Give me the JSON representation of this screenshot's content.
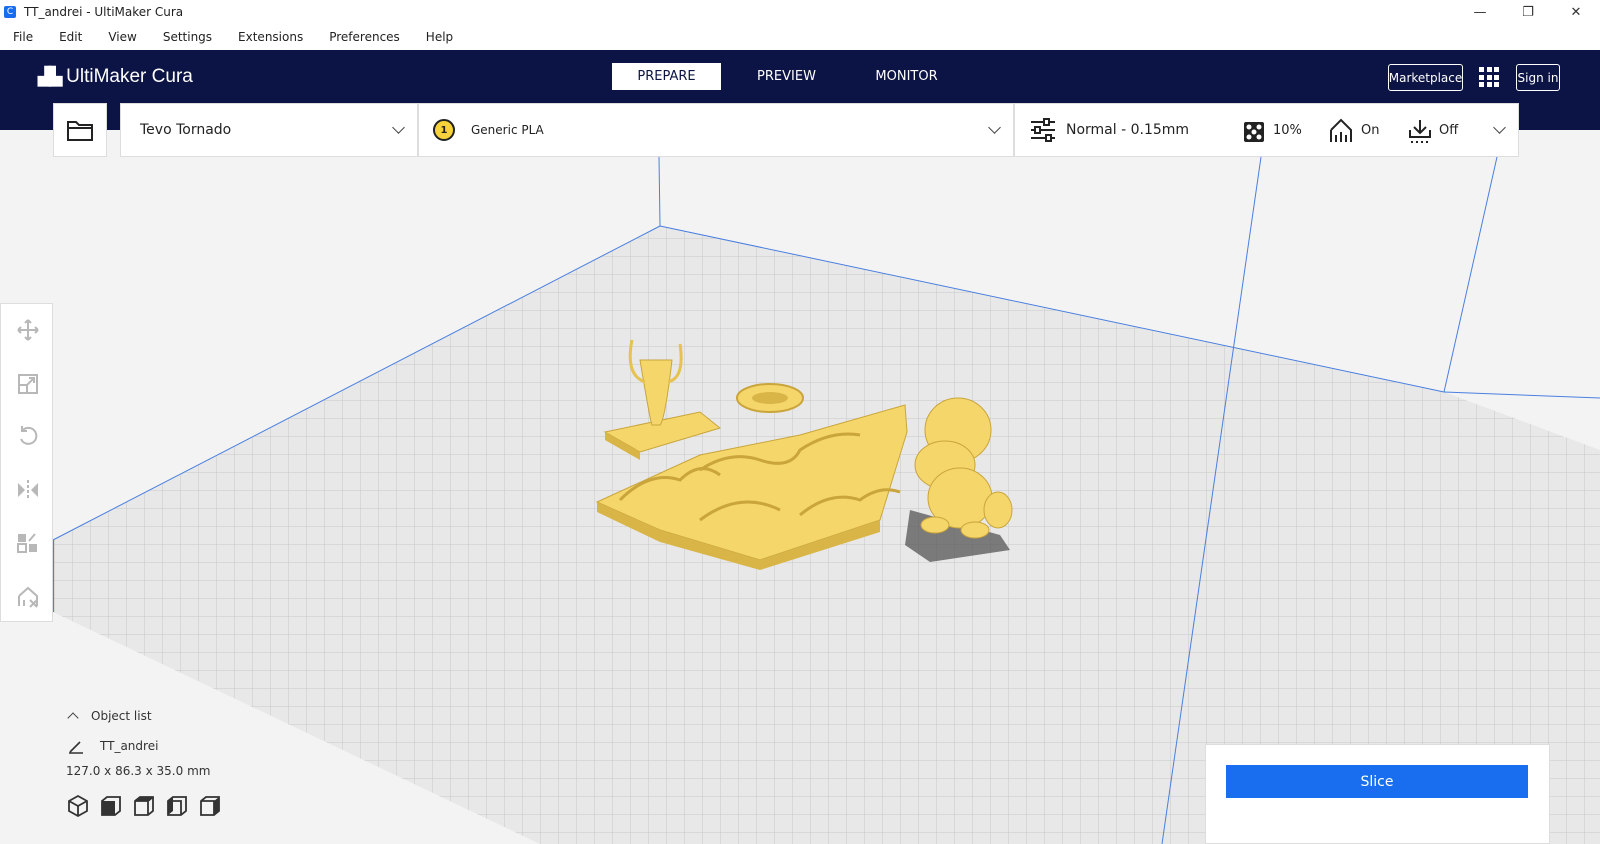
{
  "window": {
    "title": "TT_andrei - UltiMaker Cura",
    "minimize": "—",
    "maximize": "❐",
    "close": "✕"
  },
  "menu": [
    "File",
    "Edit",
    "View",
    "Settings",
    "Extensions",
    "Preferences",
    "Help"
  ],
  "header": {
    "logo": "UltiMaker Cura",
    "stages": [
      "PREPARE",
      "PREVIEW",
      "MONITOR"
    ],
    "marketplace": "Marketplace",
    "signin": "Sign in"
  },
  "printer": {
    "name": "Tevo Tornado"
  },
  "material": {
    "extruder": "1",
    "name": "Generic PLA"
  },
  "print_settings": {
    "profile": "Normal - 0.15mm",
    "infill": "10%",
    "support": "On",
    "adhesion": "Off"
  },
  "object_list": {
    "title": "Object list",
    "name": "TT_andrei",
    "dimensions": "127.0 x 86.3 x 35.0 mm"
  },
  "slice": {
    "label": "Slice"
  },
  "colors": {
    "header": "#0c1445",
    "accent": "#196ef0",
    "model": "#f5d66a"
  }
}
